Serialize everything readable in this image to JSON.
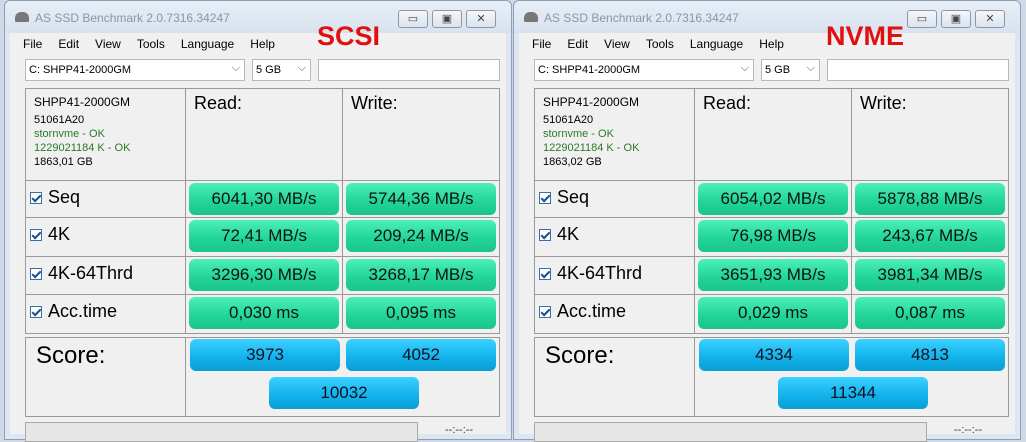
{
  "windows": [
    {
      "title": "AS SSD Benchmark 2.0.7316.34247",
      "overlay_label": "SCSI",
      "menu": [
        "File",
        "Edit",
        "View",
        "Tools",
        "Language",
        "Help"
      ],
      "drive": "C: SHPP41-2000GM",
      "size": "5 GB",
      "name": "SHPP41-2000GM",
      "firmware": "51061A20",
      "driver": "stornvme - OK",
      "alignment": "1229021184 K - OK",
      "capacity": "1863,01 GB",
      "read_header": "Read:",
      "write_header": "Write:",
      "rows": [
        {
          "label": "Seq",
          "read": "6041,30 MB/s",
          "write": "5744,36 MB/s"
        },
        {
          "label": "4K",
          "read": "72,41 MB/s",
          "write": "209,24 MB/s"
        },
        {
          "label": "4K-64Thrd",
          "read": "3296,30 MB/s",
          "write": "3268,17 MB/s"
        },
        {
          "label": "Acc.time",
          "read": "0,030 ms",
          "write": "0,095 ms"
        }
      ],
      "score_label": "Score:",
      "score_read": "3973",
      "score_write": "4052",
      "score_total": "10032",
      "time": "--:--:--"
    },
    {
      "title": "AS SSD Benchmark 2.0.7316.34247",
      "overlay_label": "NVME",
      "menu": [
        "File",
        "Edit",
        "View",
        "Tools",
        "Language",
        "Help"
      ],
      "drive": "C: SHPP41-2000GM",
      "size": "5 GB",
      "name": "SHPP41-2000GM",
      "firmware": "51061A20",
      "driver": "stornvme - OK",
      "alignment": "1229021184 K - OK",
      "capacity": "1863,02 GB",
      "read_header": "Read:",
      "write_header": "Write:",
      "rows": [
        {
          "label": "Seq",
          "read": "6054,02 MB/s",
          "write": "5878,88 MB/s"
        },
        {
          "label": "4K",
          "read": "76,98 MB/s",
          "write": "243,67 MB/s"
        },
        {
          "label": "4K-64Thrd",
          "read": "3651,93 MB/s",
          "write": "3981,34 MB/s"
        },
        {
          "label": "Acc.time",
          "read": "0,029 ms",
          "write": "0,087 ms"
        }
      ],
      "score_label": "Score:",
      "score_read": "4334",
      "score_write": "4813",
      "score_total": "11344",
      "time": "--:--:--"
    }
  ]
}
